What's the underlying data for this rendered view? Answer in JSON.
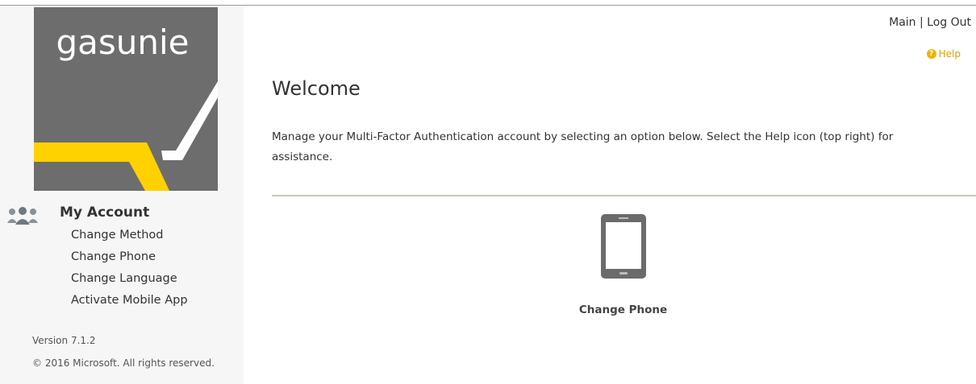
{
  "header": {
    "main_link": "Main",
    "separator": "|",
    "logout_link": "Log Out",
    "help_label": "Help",
    "help_icon": "question-circle-icon"
  },
  "sidebar": {
    "logo_text": "gasunie",
    "section_icon": "users-icon",
    "section_title": "My Account",
    "items": [
      {
        "label": "Change Method"
      },
      {
        "label": "Change Phone"
      },
      {
        "label": "Change Language"
      },
      {
        "label": "Activate Mobile App"
      }
    ],
    "version": "Version 7.1.2",
    "copyright": "© 2016 Microsoft. All rights reserved."
  },
  "main": {
    "title": "Welcome",
    "intro": "Manage your Multi-Factor Authentication account by selecting an option below. Select the Help icon (top right) for assistance.",
    "tiles": [
      {
        "icon": "mobile-phone-icon",
        "label": "Change Phone"
      }
    ]
  },
  "colors": {
    "logo_bg": "#6d6d6d",
    "logo_yellow": "#ffd100",
    "help_accent": "#f0b400",
    "divider": "#c9c9bf"
  }
}
